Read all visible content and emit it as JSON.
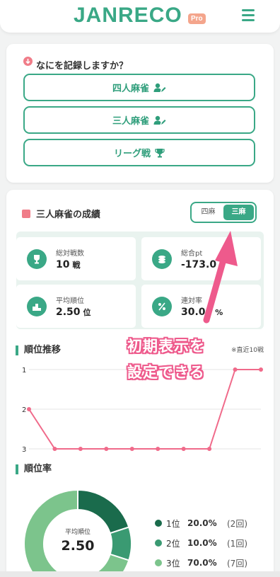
{
  "header": {
    "logo": "JANRECO",
    "badge": "Pro"
  },
  "record": {
    "question": "なにを記録しますか？",
    "buttons": [
      {
        "label": "四人麻雀",
        "icon": "user-edit-icon"
      },
      {
        "label": "三人麻雀",
        "icon": "user-edit-icon"
      },
      {
        "label": "リーグ戦",
        "icon": "trophy-icon"
      }
    ]
  },
  "results": {
    "title": "三人麻雀の成績",
    "toggle": [
      "四麻",
      "三麻"
    ],
    "toggle_selected": "三麻",
    "stats": [
      {
        "label": "総対戦数",
        "value": "10",
        "unit": "戦",
        "icon": "trophy-icon"
      },
      {
        "label": "総合pt",
        "value": "-173.0",
        "unit": "",
        "icon": "coins-icon"
      },
      {
        "label": "平均順位",
        "value": "2.50",
        "unit": "位",
        "icon": "podium-icon"
      },
      {
        "label": "連対率",
        "value": "30.00",
        "unit": "%",
        "icon": "percent-icon"
      }
    ]
  },
  "rank_trend": {
    "title": "順位推移",
    "note": "※直近10戦",
    "y_ticks": [
      "1",
      "2",
      "3"
    ]
  },
  "rank_rate": {
    "title": "順位率",
    "center_label": "平均順位",
    "center_value": "2.50",
    "legend": [
      {
        "rank": "1位",
        "pct": "20.0%",
        "count": "(2回)",
        "color": "#1a6b4c"
      },
      {
        "rank": "2位",
        "pct": "10.0%",
        "count": "(1回)",
        "color": "#3a9a72"
      },
      {
        "rank": "3位",
        "pct": "70.0%",
        "count": "(7回)",
        "color": "#7cc48c"
      }
    ]
  },
  "annotation": {
    "line1": "初期表示を",
    "line2": "設定できる"
  },
  "chart_data": [
    {
      "type": "line",
      "title": "順位推移",
      "x": [
        1,
        2,
        3,
        4,
        5,
        6,
        7,
        8,
        9,
        10
      ],
      "series": [
        {
          "values": [
            2,
            3,
            3,
            3,
            3,
            3,
            3,
            3,
            1,
            1
          ]
        }
      ],
      "ylim": [
        1,
        3
      ],
      "y_inverted": true,
      "color": "#f06a8a"
    },
    {
      "type": "pie",
      "title": "順位率",
      "categories": [
        "1位",
        "2位",
        "3位"
      ],
      "values": [
        20,
        10,
        70
      ],
      "colors": [
        "#1a6b4c",
        "#3a9a72",
        "#7cc48c"
      ]
    }
  ]
}
